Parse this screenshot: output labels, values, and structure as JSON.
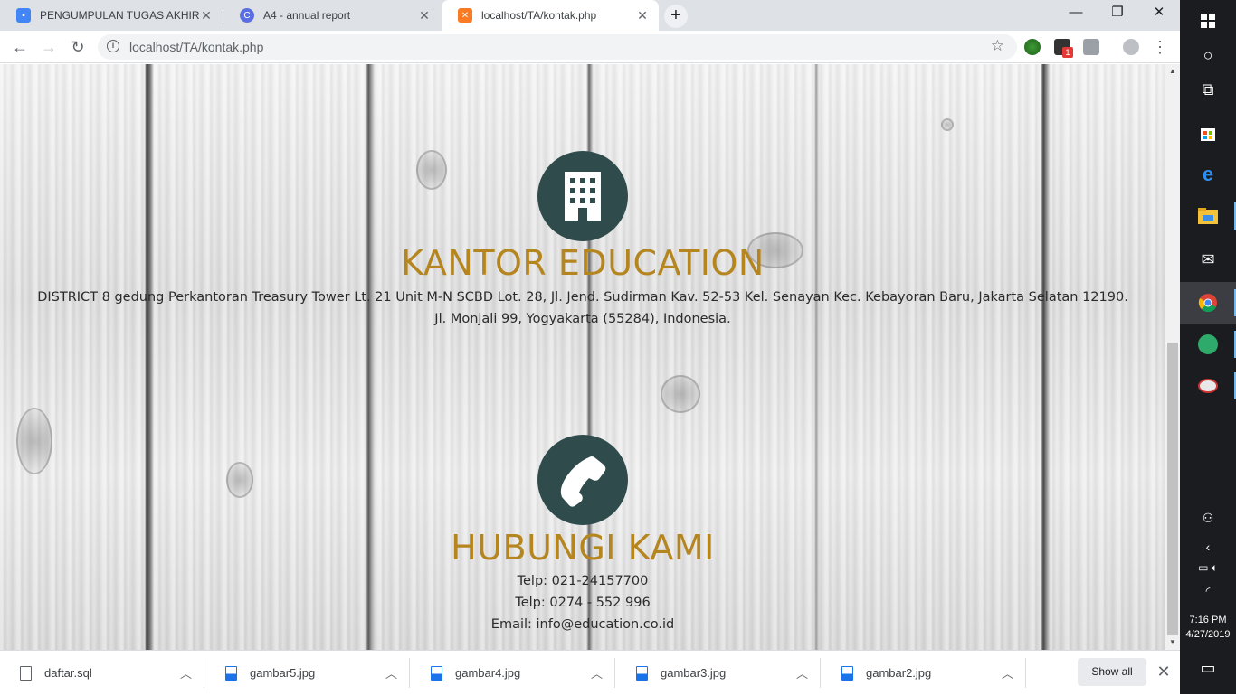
{
  "browser": {
    "tabs": [
      {
        "title": "PENGUMPULAN TUGAS AKHIR W",
        "favicon": "forms-icon",
        "color": "#4285f4",
        "active": false
      },
      {
        "title": "A4 - annual report",
        "favicon": "canva-icon",
        "color": "#5b6ee1",
        "active": false
      },
      {
        "title": "localhost/TA/kontak.php",
        "favicon": "xampp-icon",
        "color": "#fb7a24",
        "active": true
      }
    ],
    "new_tab": "+",
    "window_controls": {
      "minimize": "—",
      "maximize": "❐",
      "close": "✕"
    },
    "url": "localhost/TA/kontak.php",
    "extension_badge": "1"
  },
  "page": {
    "office": {
      "icon": "building-icon",
      "heading": "KANTOR EDUCATION",
      "address_line1": "DISTRICT 8 gedung Perkantoran Treasury Tower Lt. 21 Unit M-N SCBD Lot. 28, Jl. Jend. Sudirman Kav. 52-53 Kel. Senayan Kec. Kebayoran Baru, Jakarta Selatan 12190.",
      "address_line2": "Jl. Monjali 99, Yogyakarta (55284), Indonesia."
    },
    "contact": {
      "icon": "phone-icon",
      "heading": "HUBUNGI KAMI",
      "phone1": "Telp: 021-24157700",
      "phone2": "Telp: 0274 - 552 996",
      "email": "Email: info@education.co.id"
    },
    "colors": {
      "heading": "#b5861f",
      "icon_bg": "#2f4b4b"
    }
  },
  "downloads": {
    "items": [
      {
        "name": "daftar.sql",
        "type": "file"
      },
      {
        "name": "gambar5.jpg",
        "type": "image"
      },
      {
        "name": "gambar4.jpg",
        "type": "image"
      },
      {
        "name": "gambar3.jpg",
        "type": "image"
      },
      {
        "name": "gambar2.jpg",
        "type": "image"
      }
    ],
    "show_all": "Show all"
  },
  "taskbar": {
    "time": "7:16 PM",
    "date": "4/27/2019"
  }
}
